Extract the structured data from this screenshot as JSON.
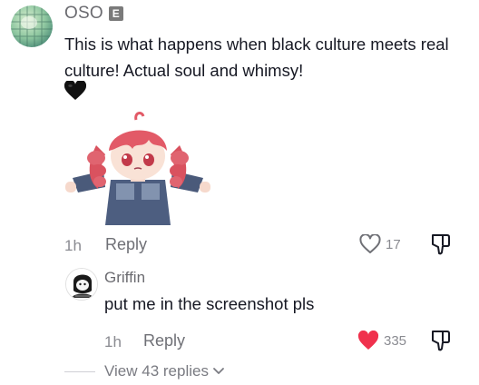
{
  "comment": {
    "username": "OSO",
    "badge": "E",
    "text": "This is what happens when black culture meets real culture! Actual soul and whimsy!",
    "time": "1h",
    "reply_label": "Reply",
    "like_count": "17"
  },
  "reply": {
    "username": "Griffin",
    "text": "put me in the screenshot pls",
    "time": "1h",
    "reply_label": "Reply",
    "like_count": "335"
  },
  "view_replies": "View 43 replies",
  "icons": {
    "heart_emoji": "black-heart-icon",
    "like_outline": "heart-outline-icon",
    "like_filled": "heart-filled-icon",
    "dislike": "thumbs-down-icon",
    "chevron": "chevron-down-icon"
  },
  "colors": {
    "liked_heart": "#f0314d",
    "secondary_text": "#8a8b91"
  }
}
